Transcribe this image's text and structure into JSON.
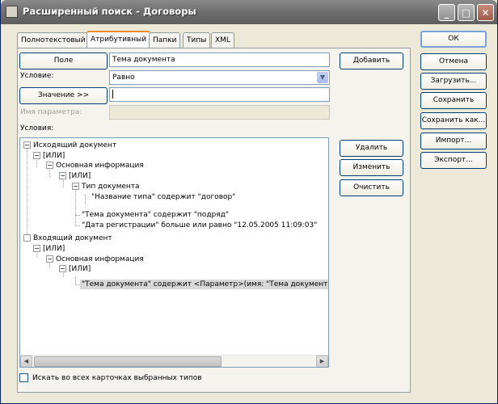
{
  "window": {
    "title": "Расширенный поиск - Договоры",
    "minimize": "_",
    "maximize": "□",
    "close": "✕"
  },
  "tabs": [
    {
      "label": "Полнотекстовый"
    },
    {
      "label": "Атрибутивный"
    },
    {
      "label": "Папки"
    },
    {
      "label": "Типы"
    },
    {
      "label": "XML"
    }
  ],
  "form": {
    "field_button": "Поле",
    "field_value": "Тема документа",
    "condition_label": "Условие:",
    "condition_value": "Равно",
    "value_button": "Значение >>",
    "value_input": "",
    "param_label": "Имя параметра:",
    "param_value": "",
    "conditions_label": "Условия:"
  },
  "tree": [
    {
      "text": "Исходящий документ"
    },
    {
      "text": "[ИЛИ]"
    },
    {
      "text": "Основная информация"
    },
    {
      "text": "[ИЛИ]"
    },
    {
      "text": "Тип документа"
    },
    {
      "text": "\"Название типа\" содержит \"договор\""
    },
    {
      "text": "\"Тема документа\" содержит \"подряд\""
    },
    {
      "text": "\"Дата регистрации\" больше или равно \"12.05.2005 11:09:03\""
    },
    {
      "text": "Входящий документ"
    },
    {
      "text": "[ИЛИ]"
    },
    {
      "text": "Основная информация"
    },
    {
      "text": "[ИЛИ]"
    },
    {
      "text": "\"Тема документа\" содержит <Параметр>(имя: \"Тема документа\", з"
    }
  ],
  "actions": {
    "add": "Добавить",
    "delete": "Удалить",
    "change": "Изменить",
    "clear": "Очистить"
  },
  "side": {
    "ok": "ОК",
    "cancel": "Отмена",
    "load": "Загрузить...",
    "save": "Сохранить",
    "save_as": "Сохранить как...",
    "import": "Импорт...",
    "export": "Экспорт..."
  },
  "checkbox_label": "Искать во всех карточках выбранных типов"
}
